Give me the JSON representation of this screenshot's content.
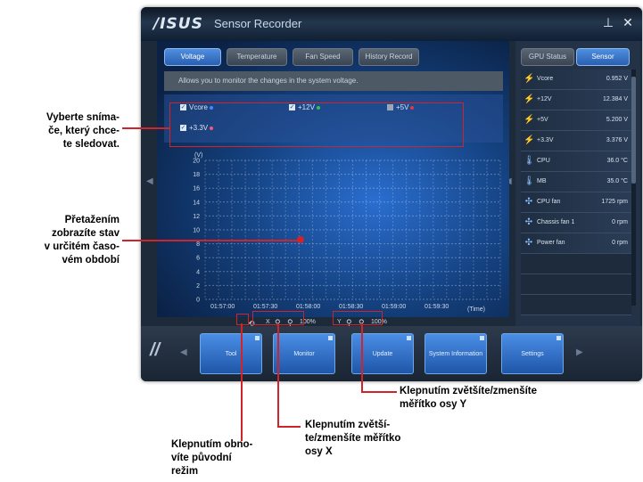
{
  "window": {
    "logo": "/ISUS",
    "title": "Sensor Recorder",
    "minimize_icon": "minimize-icon",
    "close_icon": "close-icon"
  },
  "tabs": [
    "Voltage",
    "Temperature",
    "Fan Speed",
    "History Record"
  ],
  "description": "Allows you to monitor the changes in the system voltage.",
  "sensors": [
    {
      "label": "Vcore",
      "color": "#3c8cff"
    },
    {
      "label": "+12V",
      "color": "#34c24a"
    },
    {
      "label": "+5V",
      "color": "#e23a3a"
    },
    {
      "label": "+3.3V",
      "color": "#ff5577"
    }
  ],
  "chart_data": {
    "type": "line",
    "ylabel": "(V)",
    "xlabel": "(Time)",
    "y_ticks": [
      "20",
      "18",
      "16",
      "14",
      "12",
      "10",
      "8",
      "6",
      "4",
      "2",
      "0"
    ],
    "x_ticks": [
      "01:57:00",
      "01:57:30",
      "01:58:00",
      "01:58:30",
      "01:59:00",
      "01:59:30"
    ],
    "ylim": [
      0,
      20
    ],
    "grid": true,
    "series": []
  },
  "zoom": {
    "x_label": "X",
    "x_value": "100%",
    "y_label": "Y",
    "y_value": "100%"
  },
  "right_tabs": [
    "GPU Status",
    "Sensor"
  ],
  "sensor_list": [
    {
      "icon": "bolt-icon",
      "name": "Vcore",
      "value": "0.952 V"
    },
    {
      "icon": "bolt-icon",
      "name": "+12V",
      "value": "12.384 V"
    },
    {
      "icon": "bolt-icon",
      "name": "+5V",
      "value": "5.200 V"
    },
    {
      "icon": "bolt-icon",
      "name": "+3.3V",
      "value": "3.376 V"
    },
    {
      "icon": "thermometer-icon",
      "name": "CPU",
      "value": "36.0 °C"
    },
    {
      "icon": "thermometer-icon",
      "name": "MB",
      "value": "35.0 °C"
    },
    {
      "icon": "fan-icon",
      "name": "CPU fan",
      "value": "1725 rpm"
    },
    {
      "icon": "fan-icon",
      "name": "Chassis fan 1",
      "value": "0 rpm"
    },
    {
      "icon": "fan-icon",
      "name": "Power fan",
      "value": "0 rpm"
    }
  ],
  "nav": [
    "Tool",
    "Monitor",
    "Update",
    "System Information",
    "Settings"
  ],
  "annotations": {
    "select_sensors": "Vyberte sníma-\nče, který chce-\nte sledovat.",
    "drag_state": "Přetažením\nzobrazíte stav\nv určitém časo-\nvém období",
    "zoom_y": "Klepnutím zvětšíte/zmenšíte\nměřítko osy Y",
    "zoom_x": "Klepnutím zvětší-\nte/zmenšíte měřítko\nosy X",
    "restore": "Klepnutím obno-\nvíte původní\nrežim"
  },
  "colors": {
    "accent": "#2f6fd0",
    "callout": "#d0232a"
  }
}
